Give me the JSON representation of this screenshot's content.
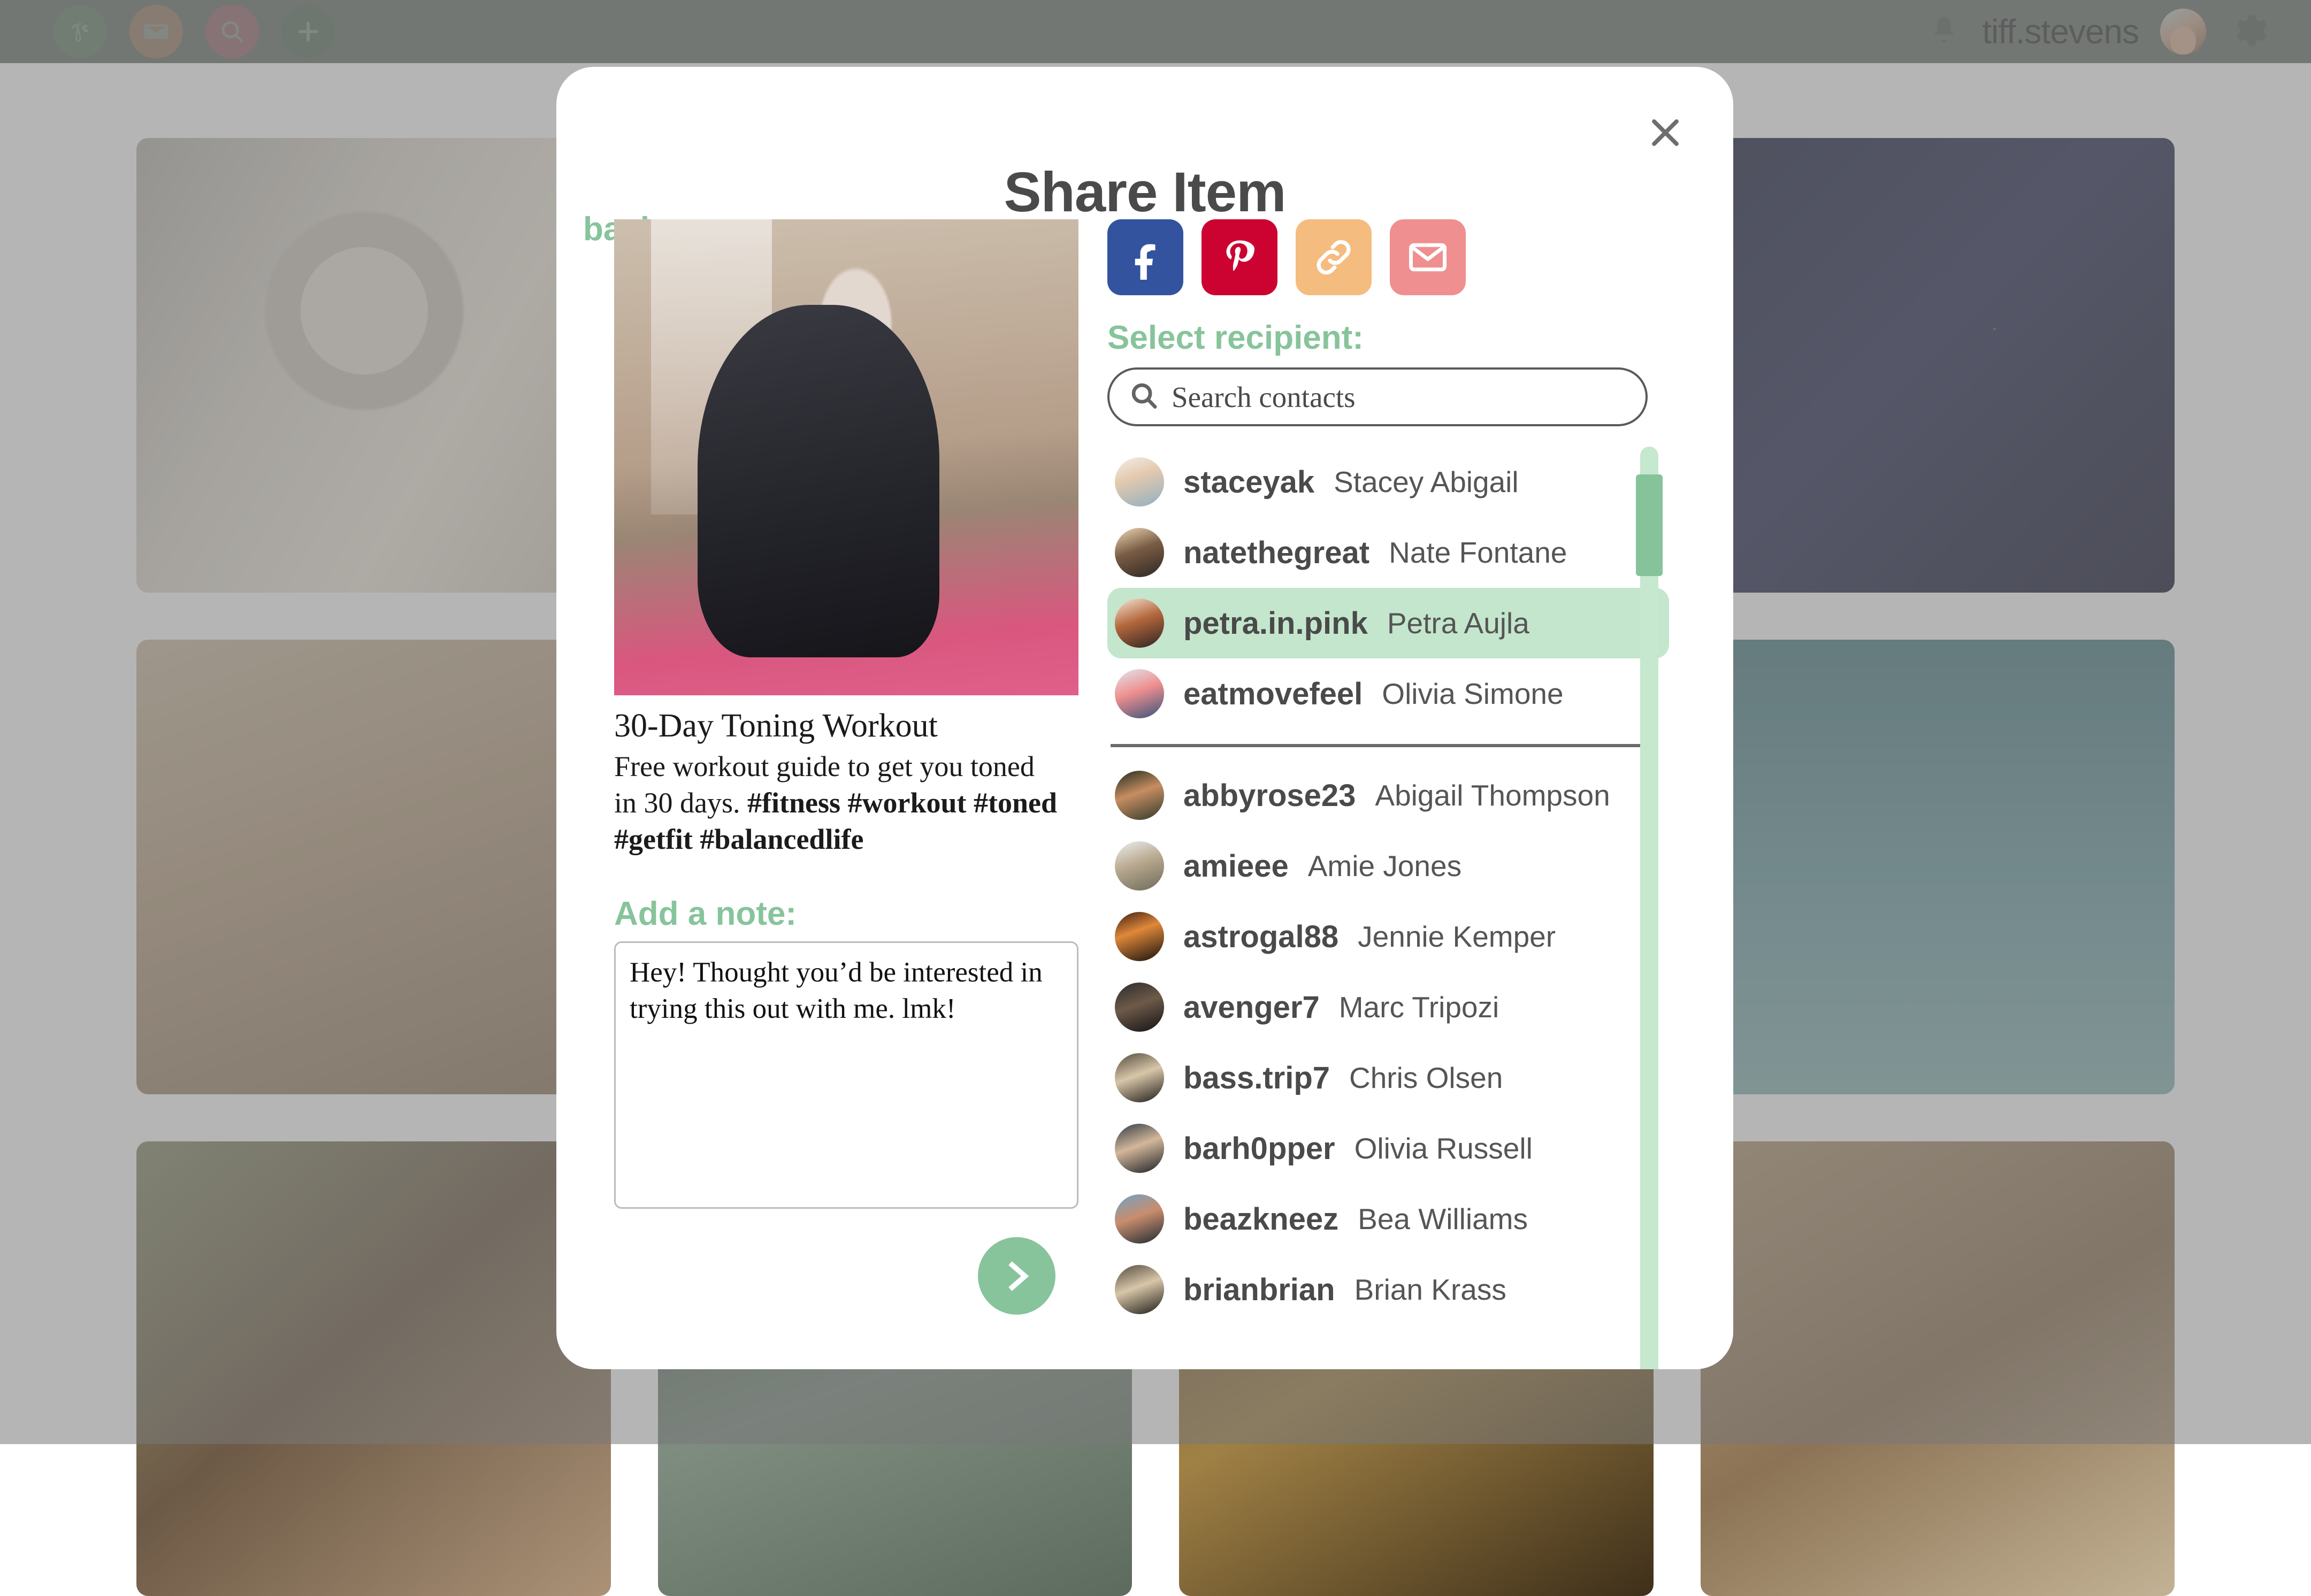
{
  "topbar": {
    "brand_icon": "brand-leaf-icon",
    "mail_icon": "mail-icon",
    "search_icon": "search-icon",
    "add_icon": "plus-icon",
    "bell_icon": "bell-icon",
    "username": "tiff.stevens",
    "avatar": "user-avatar",
    "gear_icon": "gear-icon"
  },
  "modal": {
    "title": "Share Item",
    "back_label": "back",
    "close_icon": "close-icon",
    "next_icon": "chevron-right-icon"
  },
  "item": {
    "title": "30-Day Toning Workout",
    "desc_plain": "Free workout guide to get you toned in 30 days. ",
    "desc_tags": "#fitness #workout #toned #getfit #balancedlife"
  },
  "note": {
    "label": "Add a note:",
    "value": "Hey! Thought you’d be interested in trying this out with me. lmk!",
    "placeholder": ""
  },
  "social": [
    {
      "name": "facebook",
      "label": "f",
      "color": "#33539e"
    },
    {
      "name": "pinterest",
      "label": "p",
      "color": "#cc0331"
    },
    {
      "name": "copy-link",
      "label": "link",
      "color": "#f5bc7f"
    },
    {
      "name": "email",
      "label": "mail",
      "color": "#ef8f90"
    }
  ],
  "recipients": {
    "label": "Select recipient:",
    "search_placeholder": "Search contacts",
    "search_value": "",
    "accent": "#87c49b",
    "selected_highlight": "#c4e6cd",
    "suggested": [
      {
        "handle": "staceyak",
        "name": "Stacey Abigail",
        "selected": false
      },
      {
        "handle": "natethegreat",
        "name": "Nate Fontane",
        "selected": false
      },
      {
        "handle": "petra.in.pink",
        "name": "Petra Aujla",
        "selected": true
      },
      {
        "handle": "eatmovefeel",
        "name": "Olivia Simone",
        "selected": false
      }
    ],
    "all": [
      {
        "handle": "abbyrose23",
        "name": "Abigail Thompson",
        "selected": false
      },
      {
        "handle": "amieee",
        "name": "Amie Jones",
        "selected": false
      },
      {
        "handle": "astrogal88",
        "name": "Jennie Kemper",
        "selected": false
      },
      {
        "handle": "avenger7",
        "name": "Marc Tripozi",
        "selected": false
      },
      {
        "handle": "bass.trip7",
        "name": "Chris Olsen",
        "selected": false
      },
      {
        "handle": "barh0pper",
        "name": "Olivia Russell",
        "selected": false
      },
      {
        "handle": "beazkneez",
        "name": "Bea Williams",
        "selected": false
      },
      {
        "handle": "brianbrian",
        "name": "Brian Krass",
        "selected": false
      }
    ]
  }
}
